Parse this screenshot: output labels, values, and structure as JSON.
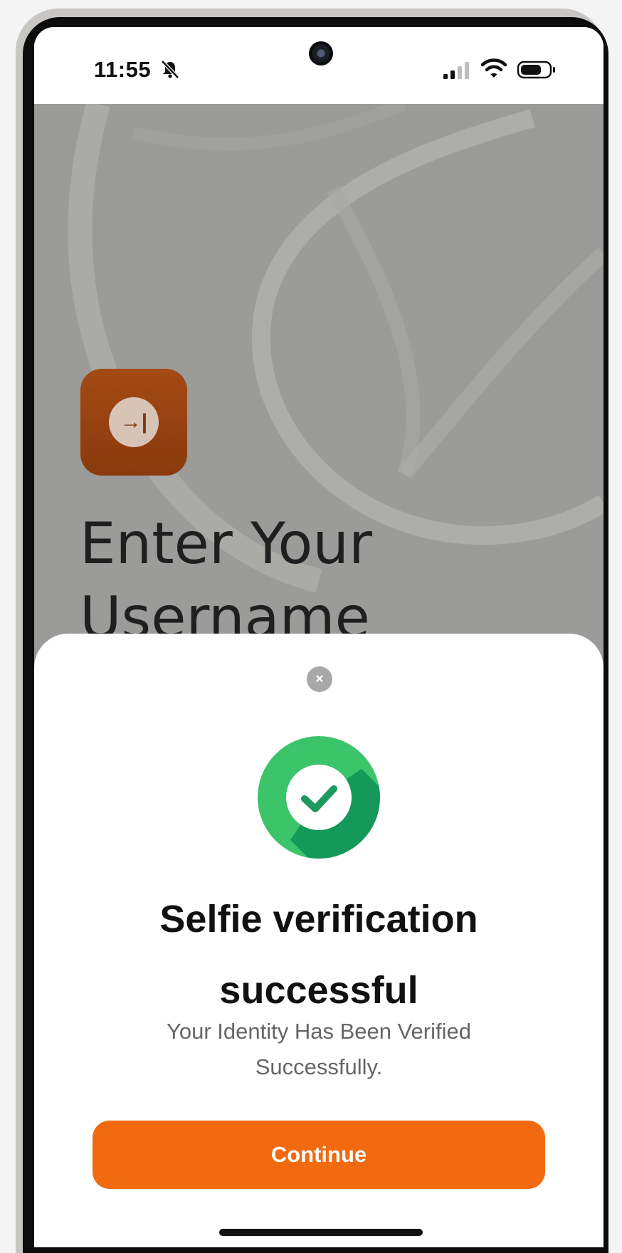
{
  "status_bar": {
    "time": "11:55",
    "icons": [
      "bell-slash-icon",
      "signal-icon",
      "wifi-icon",
      "battery-icon"
    ]
  },
  "background_screen": {
    "logo_icon": "login-arrow-icon",
    "logo_glyph": "→|",
    "title": "Enter Your Username"
  },
  "sheet": {
    "close_glyph": "×",
    "status_icon": "check-circle-icon",
    "title": "Selfie verification successful",
    "subtitle": "Your Identity Has Been Verified Successfully.",
    "continue_label": "Continue"
  },
  "colors": {
    "accent": "#f26a10",
    "success_light": "#3cc46b",
    "success_dark": "#14995a",
    "logo_tile": "#9a4411"
  }
}
